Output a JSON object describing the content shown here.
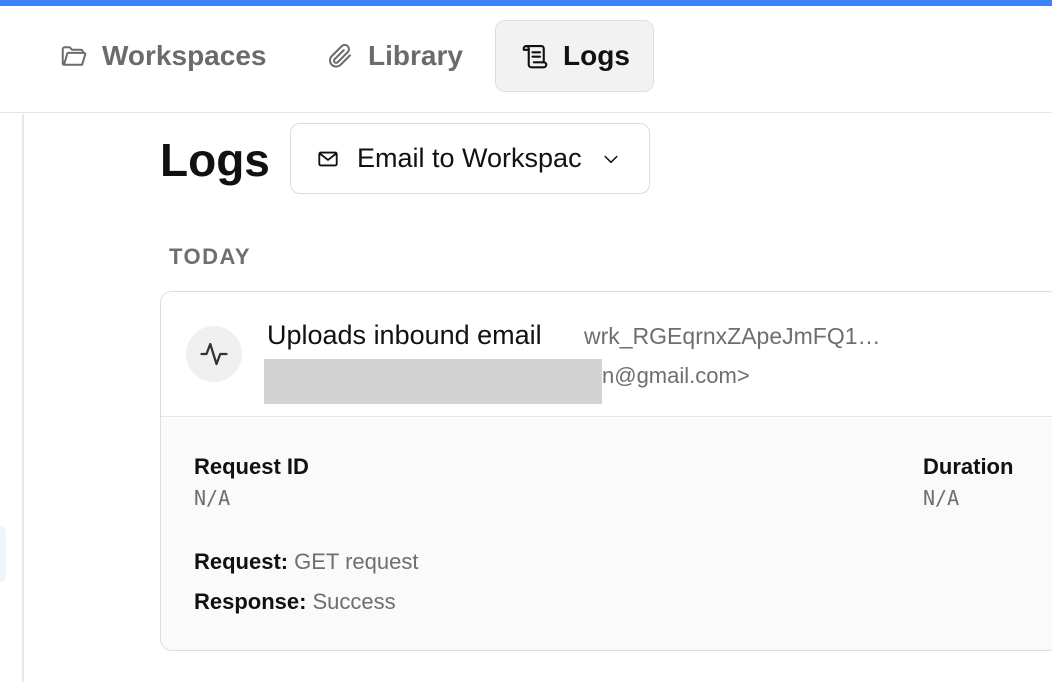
{
  "colors": {
    "accent_bar": "#3b82f6",
    "active_tab_bg": "#f2f2f2",
    "muted_text": "#6e6e6e",
    "redaction": "#d3d3d3"
  },
  "nav": {
    "tabs": [
      {
        "label": "Workspaces",
        "icon": "folder-icon",
        "active": false
      },
      {
        "label": "Library",
        "icon": "paperclip-icon",
        "active": false
      },
      {
        "label": "Logs",
        "icon": "scroll-icon",
        "active": true
      }
    ]
  },
  "header": {
    "title": "Logs",
    "filter": {
      "icon": "mail-icon",
      "value": "Email to Workspac",
      "chevron": "chevron-down-icon"
    }
  },
  "logs": {
    "section_label": "TODAY",
    "entry": {
      "icon": "activity-icon",
      "title": "Uploads inbound email",
      "workflow_id": "wrk_RGEqrnxZApeJmFQ1…",
      "sender_visible": "n@gmail.com>",
      "request_id_label": "Request ID",
      "request_id_value": "N/A",
      "duration_label": "Duration",
      "duration_value": "N/A",
      "request_label": "Request:",
      "request_value": "GET request",
      "response_label": "Response:",
      "response_value": "Success"
    }
  }
}
